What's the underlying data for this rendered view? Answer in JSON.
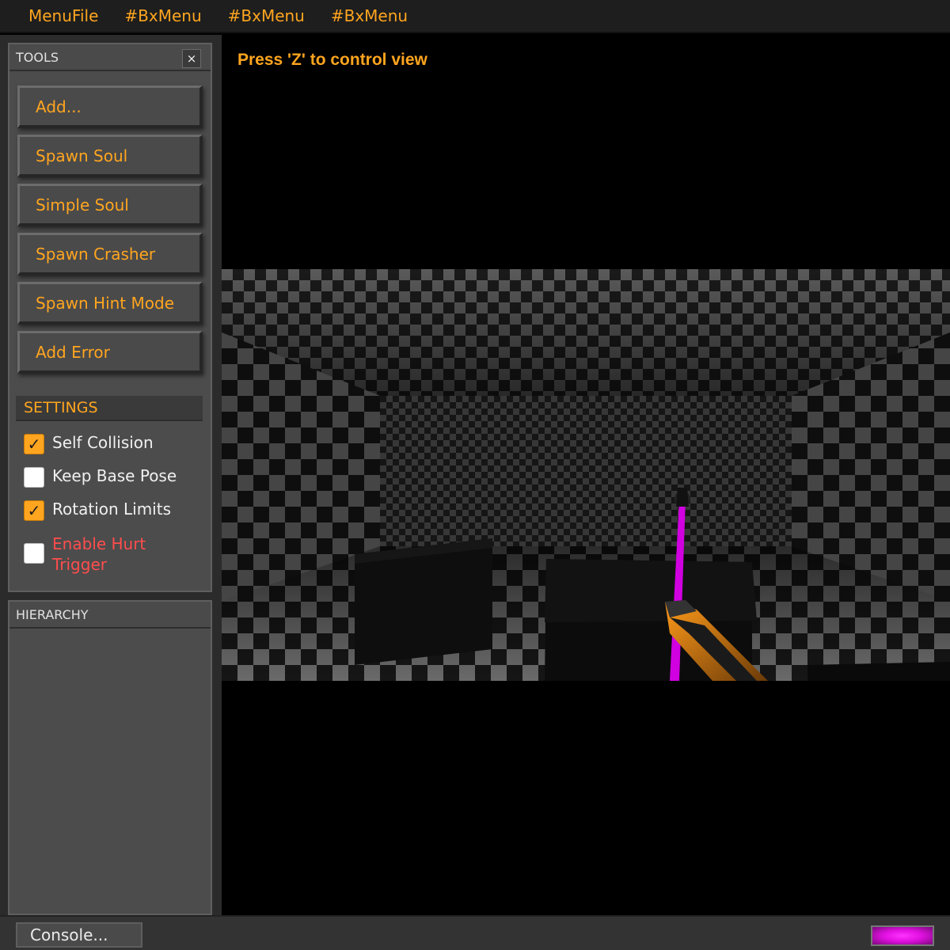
{
  "menubar": {
    "items": [
      "MenuFile",
      "#BxMenu",
      "#BxMenu",
      "#BxMenu"
    ]
  },
  "tools_panel": {
    "title": "TOOLS",
    "close_glyph": "×",
    "buttons": [
      "Add...",
      "Spawn Soul",
      "Simple Soul",
      "Spawn Crasher",
      "Spawn Hint Mode",
      "Add Error"
    ]
  },
  "settings": {
    "title": "SETTINGS",
    "options": [
      {
        "label": "Self Collision",
        "checked": true
      },
      {
        "label": "Keep Base Pose",
        "checked": false
      },
      {
        "label": "Rotation Limits",
        "checked": true
      },
      {
        "label": "Enable Hurt Trigger",
        "checked": false
      }
    ]
  },
  "hierarchy_panel": {
    "title": "HIERARCHY"
  },
  "viewport": {
    "hint": "Press 'Z' to control view"
  },
  "statusbar": {
    "console_label": "Console...",
    "meter_level": 1.0
  },
  "colors": {
    "accent": "#ffa51f",
    "warning": "#ff4d4d",
    "magenta": "#e010e0",
    "panel": "#4c4c4c"
  }
}
